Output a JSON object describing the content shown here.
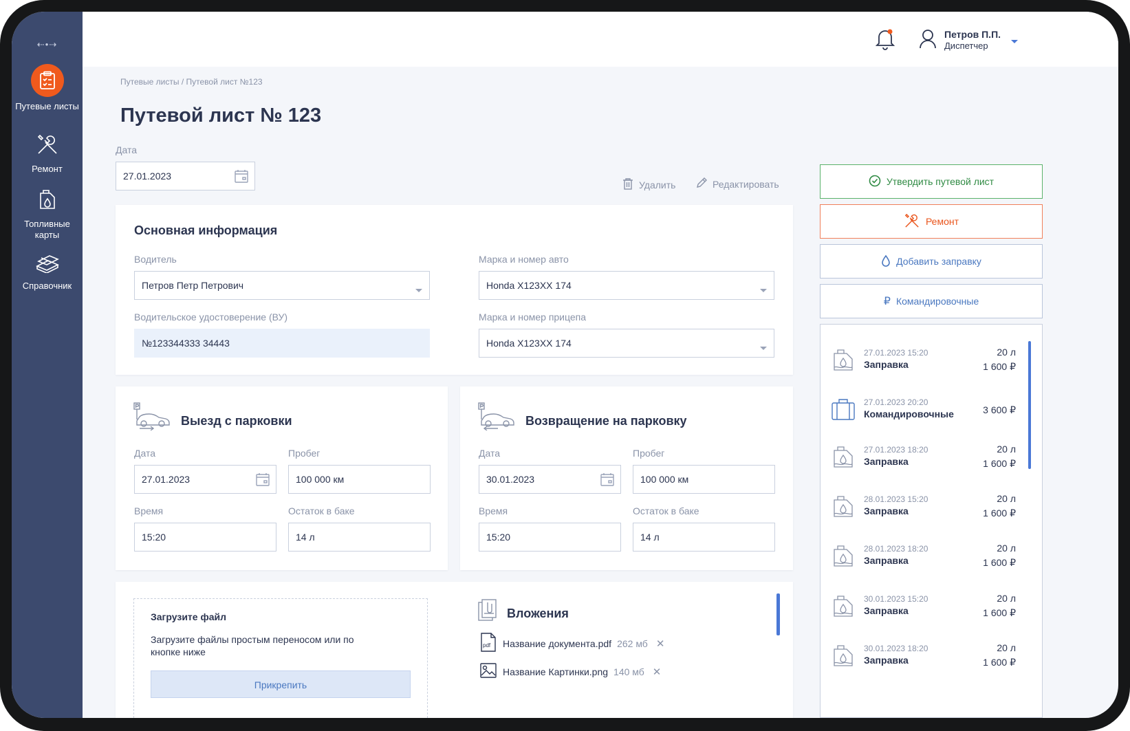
{
  "sidebar": {
    "toggle": "⇠•⇢",
    "items": [
      {
        "label": "Путевые листы",
        "icon": "clipboard-icon"
      },
      {
        "label": "Ремонт",
        "icon": "tools-icon"
      },
      {
        "label": "Топливные карты",
        "icon": "fuel-can-icon"
      },
      {
        "label": "Справочник",
        "icon": "books-icon"
      }
    ]
  },
  "topbar": {
    "user_name": "Петров П.П.",
    "user_role": "Диспетчер"
  },
  "breadcrumb": "Путевые листы / Путевой лист №123",
  "title": "Путевой лист № 123",
  "date": {
    "label": "Дата",
    "value": "27.01.2023"
  },
  "actions": {
    "delete": "Удалить",
    "edit": "Редактировать"
  },
  "main_info": {
    "title": "Основная информация",
    "driver_label": "Водитель",
    "driver_value": "Петров Петр Петрович",
    "license_label": "Водительское удостоверение (ВУ)",
    "license_value": "№123344333 34443",
    "car_label": "Марка и номер авто",
    "car_value": "Honda X123XX 174",
    "trailer_label": "Марка и номер прицепа",
    "trailer_value": "Honda X123XX 174"
  },
  "departure": {
    "title": "Выезд с парковки",
    "date_label": "Дата",
    "date_value": "27.01.2023",
    "mileage_label": "Пробег",
    "mileage_value": "100 000 км",
    "time_label": "Время",
    "time_value": "15:20",
    "fuel_label": "Остаток в баке",
    "fuel_value": "14 л"
  },
  "return": {
    "title": "Возвращение на парковку",
    "date_label": "Дата",
    "date_value": "30.01.2023",
    "mileage_label": "Пробег",
    "mileage_value": "100 000 км",
    "time_label": "Время",
    "time_value": "15:20",
    "fuel_label": "Остаток в баке",
    "fuel_value": "14 л"
  },
  "upload": {
    "title": "Загрузите файл",
    "desc": "Загрузите файлы простым переносом или по кнопке ниже",
    "button": "Прикрепить"
  },
  "attachments": {
    "title": "Вложения",
    "files": [
      {
        "name": "Название документа.pdf",
        "size": "262 мб",
        "type": "pdf"
      },
      {
        "name": "Название Картинки.png",
        "size": "140 мб",
        "type": "image"
      }
    ]
  },
  "side_buttons": {
    "approve": "Утвердить путевой лист",
    "repair": "Ремонт",
    "add_refuel": "Добавить заправку",
    "travel": "Командировочные"
  },
  "operations": [
    {
      "date": "27.01.2023 15:20",
      "title": "Заправка",
      "volume": "20 л",
      "sum": "1 600 ₽",
      "icon": "fuel-can-icon"
    },
    {
      "date": "27.01.2023 20:20",
      "title": "Командировочные",
      "volume": "",
      "sum": "3 600 ₽",
      "icon": "suitcase-icon"
    },
    {
      "date": "27.01.2023 18:20",
      "title": "Заправка",
      "volume": "20 л",
      "sum": "1 600 ₽",
      "icon": "fuel-can-icon"
    },
    {
      "date": "28.01.2023 15:20",
      "title": "Заправка",
      "volume": "20 л",
      "sum": "1 600 ₽",
      "icon": "fuel-can-icon"
    },
    {
      "date": "28.01.2023 18:20",
      "title": "Заправка",
      "volume": "20 л",
      "sum": "1 600 ₽",
      "icon": "fuel-can-icon"
    },
    {
      "date": "30.01.2023 15:20",
      "title": "Заправка",
      "volume": "20 л",
      "sum": "1 600 ₽",
      "icon": "fuel-can-icon"
    },
    {
      "date": "30.01.2023 18:20",
      "title": "Заправка",
      "volume": "20 л",
      "sum": "1 600 ₽",
      "icon": "fuel-can-icon"
    }
  ],
  "colors": {
    "sidebar": "#3c4a6e",
    "accent_orange": "#f05a1d",
    "approve_green": "#2f8a43",
    "link_blue": "#4a78c0"
  }
}
